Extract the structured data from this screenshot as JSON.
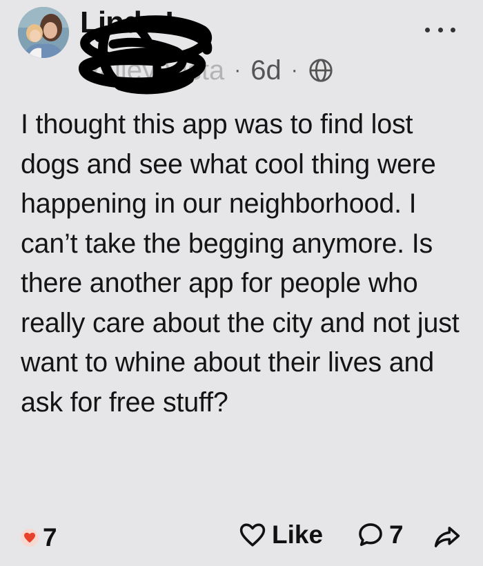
{
  "post": {
    "author_name": "Linda L.",
    "neighborhood": "Valley Vista",
    "time_ago": "6d",
    "separator": "·",
    "visibility_icon": "globe-icon",
    "menu_icon": "more-horizontal-icon",
    "body": "I thought this app was to find lost dogs and see what cool thing were happening in our neighborhood. I can’t take the begging anymore. Is there another app for people who really care about the city and not just want to whine about their lives and ask for free stuff?"
  },
  "footer": {
    "reaction_icon": "heart-icon",
    "reaction_count": "7",
    "like_label": "Like",
    "like_icon": "heart-outline-icon",
    "comment_icon": "comment-bubble-icon",
    "comment_count": "7",
    "share_icon": "share-arrow-icon"
  },
  "colors": {
    "background": "#e6e6e8",
    "text": "#141414",
    "meta_text": "#555555",
    "reaction_heart": "#e8412b",
    "reaction_badge_bg": "#f7d9d2",
    "redaction_scribble": "#000000"
  }
}
